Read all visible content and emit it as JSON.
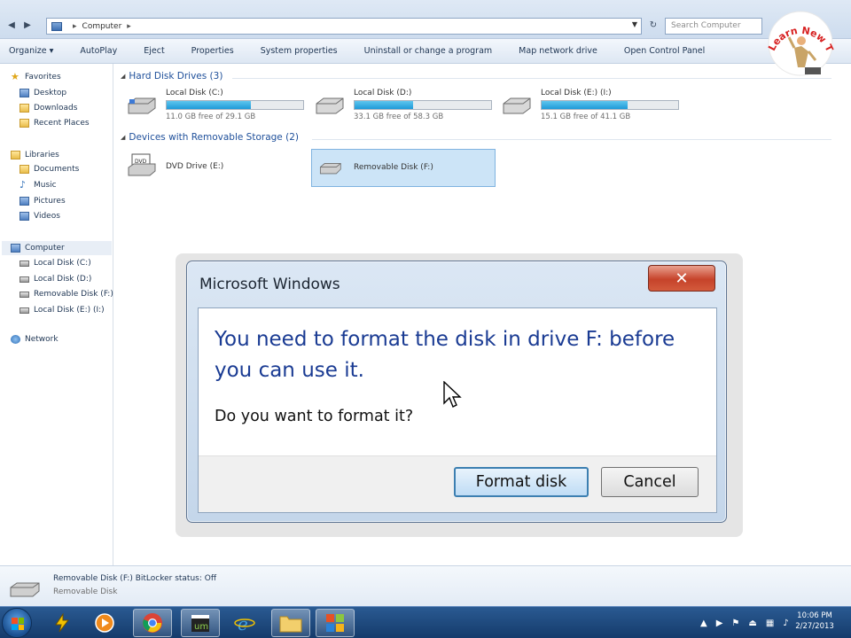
{
  "address_bar": {
    "path": [
      "Computer"
    ],
    "search_placeholder": "Search Computer"
  },
  "toolbar": {
    "commands": [
      "Organize ▾",
      "AutoPlay",
      "Eject",
      "Properties",
      "System properties",
      "Uninstall or change a program",
      "Map network drive",
      "Open Control Panel"
    ]
  },
  "logo": {
    "text": "Learn New Things"
  },
  "nav": {
    "favorites": {
      "label": "Favorites",
      "items": [
        "Desktop",
        "Downloads",
        "Recent Places"
      ]
    },
    "libraries": {
      "label": "Libraries",
      "items": [
        "Documents",
        "Music",
        "Pictures",
        "Videos"
      ]
    },
    "computer": {
      "label": "Computer",
      "items": [
        "Local Disk (C:)",
        "Local Disk (D:)",
        "Removable Disk (F:)",
        "Local Disk (E:) (I:)"
      ]
    },
    "network": {
      "label": "Network"
    }
  },
  "content": {
    "hard_disks": {
      "header": "Hard Disk Drives (3)",
      "drives": [
        {
          "name": "Local Disk (C:)",
          "free_text": "11.0 GB free of 29.1 GB",
          "used_fraction": 0.62
        },
        {
          "name": "Local Disk (D:)",
          "free_text": "33.1 GB free of 58.3 GB",
          "used_fraction": 0.43
        },
        {
          "name": "Local Disk (E:) (I:)",
          "free_text": "15.1 GB free of 41.1 GB",
          "used_fraction": 0.63
        }
      ]
    },
    "removable": {
      "header": "Devices with Removable Storage (2)",
      "devices": [
        {
          "name": "DVD Drive (E:)"
        },
        {
          "name": "Removable Disk (F:)"
        }
      ]
    }
  },
  "details": {
    "line1": "Removable Disk (F:)   BitLocker status: Off",
    "line2": "Removable Disk"
  },
  "dialog": {
    "title": "Microsoft Windows",
    "message": "You need to format the disk in drive F: before you can use it.",
    "question": "Do you want to format it?",
    "primary_button": "Format disk",
    "cancel_button": "Cancel"
  },
  "taskbar": {
    "clock_time": "10:06 PM",
    "clock_date": "2/27/2013"
  }
}
